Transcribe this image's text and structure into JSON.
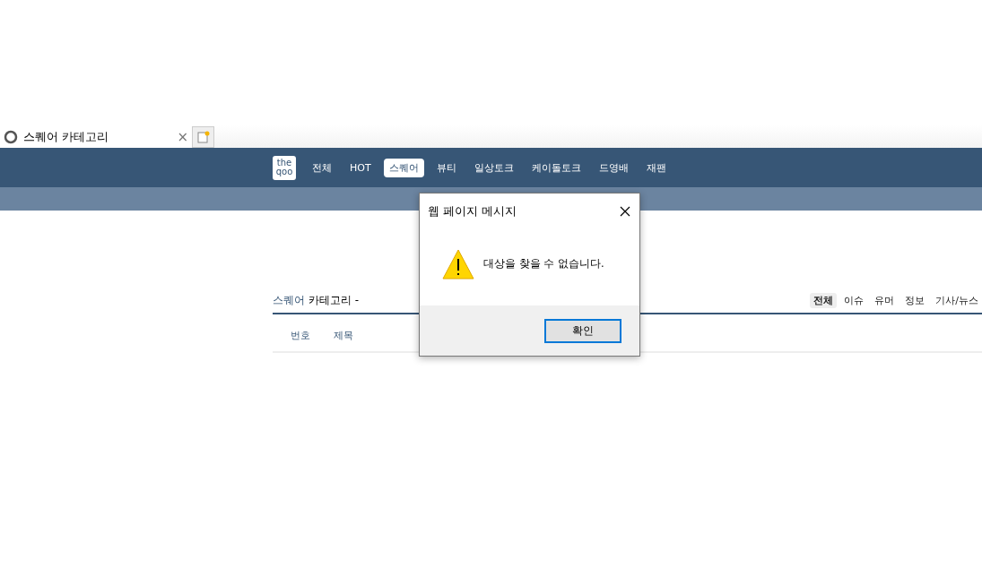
{
  "browser_tab": {
    "title": "스퀘어 카테고리",
    "close": "×"
  },
  "logo": [
    "the",
    "qoo"
  ],
  "nav": [
    {
      "label": "전체",
      "selected": false
    },
    {
      "label": "HOT",
      "selected": false
    },
    {
      "label": "스퀘어",
      "selected": true
    },
    {
      "label": "뷰티",
      "selected": false
    },
    {
      "label": "일상토크",
      "selected": false
    },
    {
      "label": "케이돌토크",
      "selected": false
    },
    {
      "label": "드영배",
      "selected": false
    },
    {
      "label": "재팬",
      "selected": false
    }
  ],
  "heading": {
    "board": "스퀘어",
    "rest": "카테고리 -"
  },
  "filters": [
    {
      "label": "전체",
      "selected": true
    },
    {
      "label": "이슈",
      "selected": false
    },
    {
      "label": "유머",
      "selected": false
    },
    {
      "label": "정보",
      "selected": false
    },
    {
      "label": "기사/뉴스",
      "selected": false
    }
  ],
  "table": {
    "columns": [
      "번호",
      "제목"
    ]
  },
  "dialog": {
    "title": "웹 페이지 메시지",
    "message": "대상을 찾을 수 없습니다.",
    "buttons": [
      "확인"
    ]
  }
}
